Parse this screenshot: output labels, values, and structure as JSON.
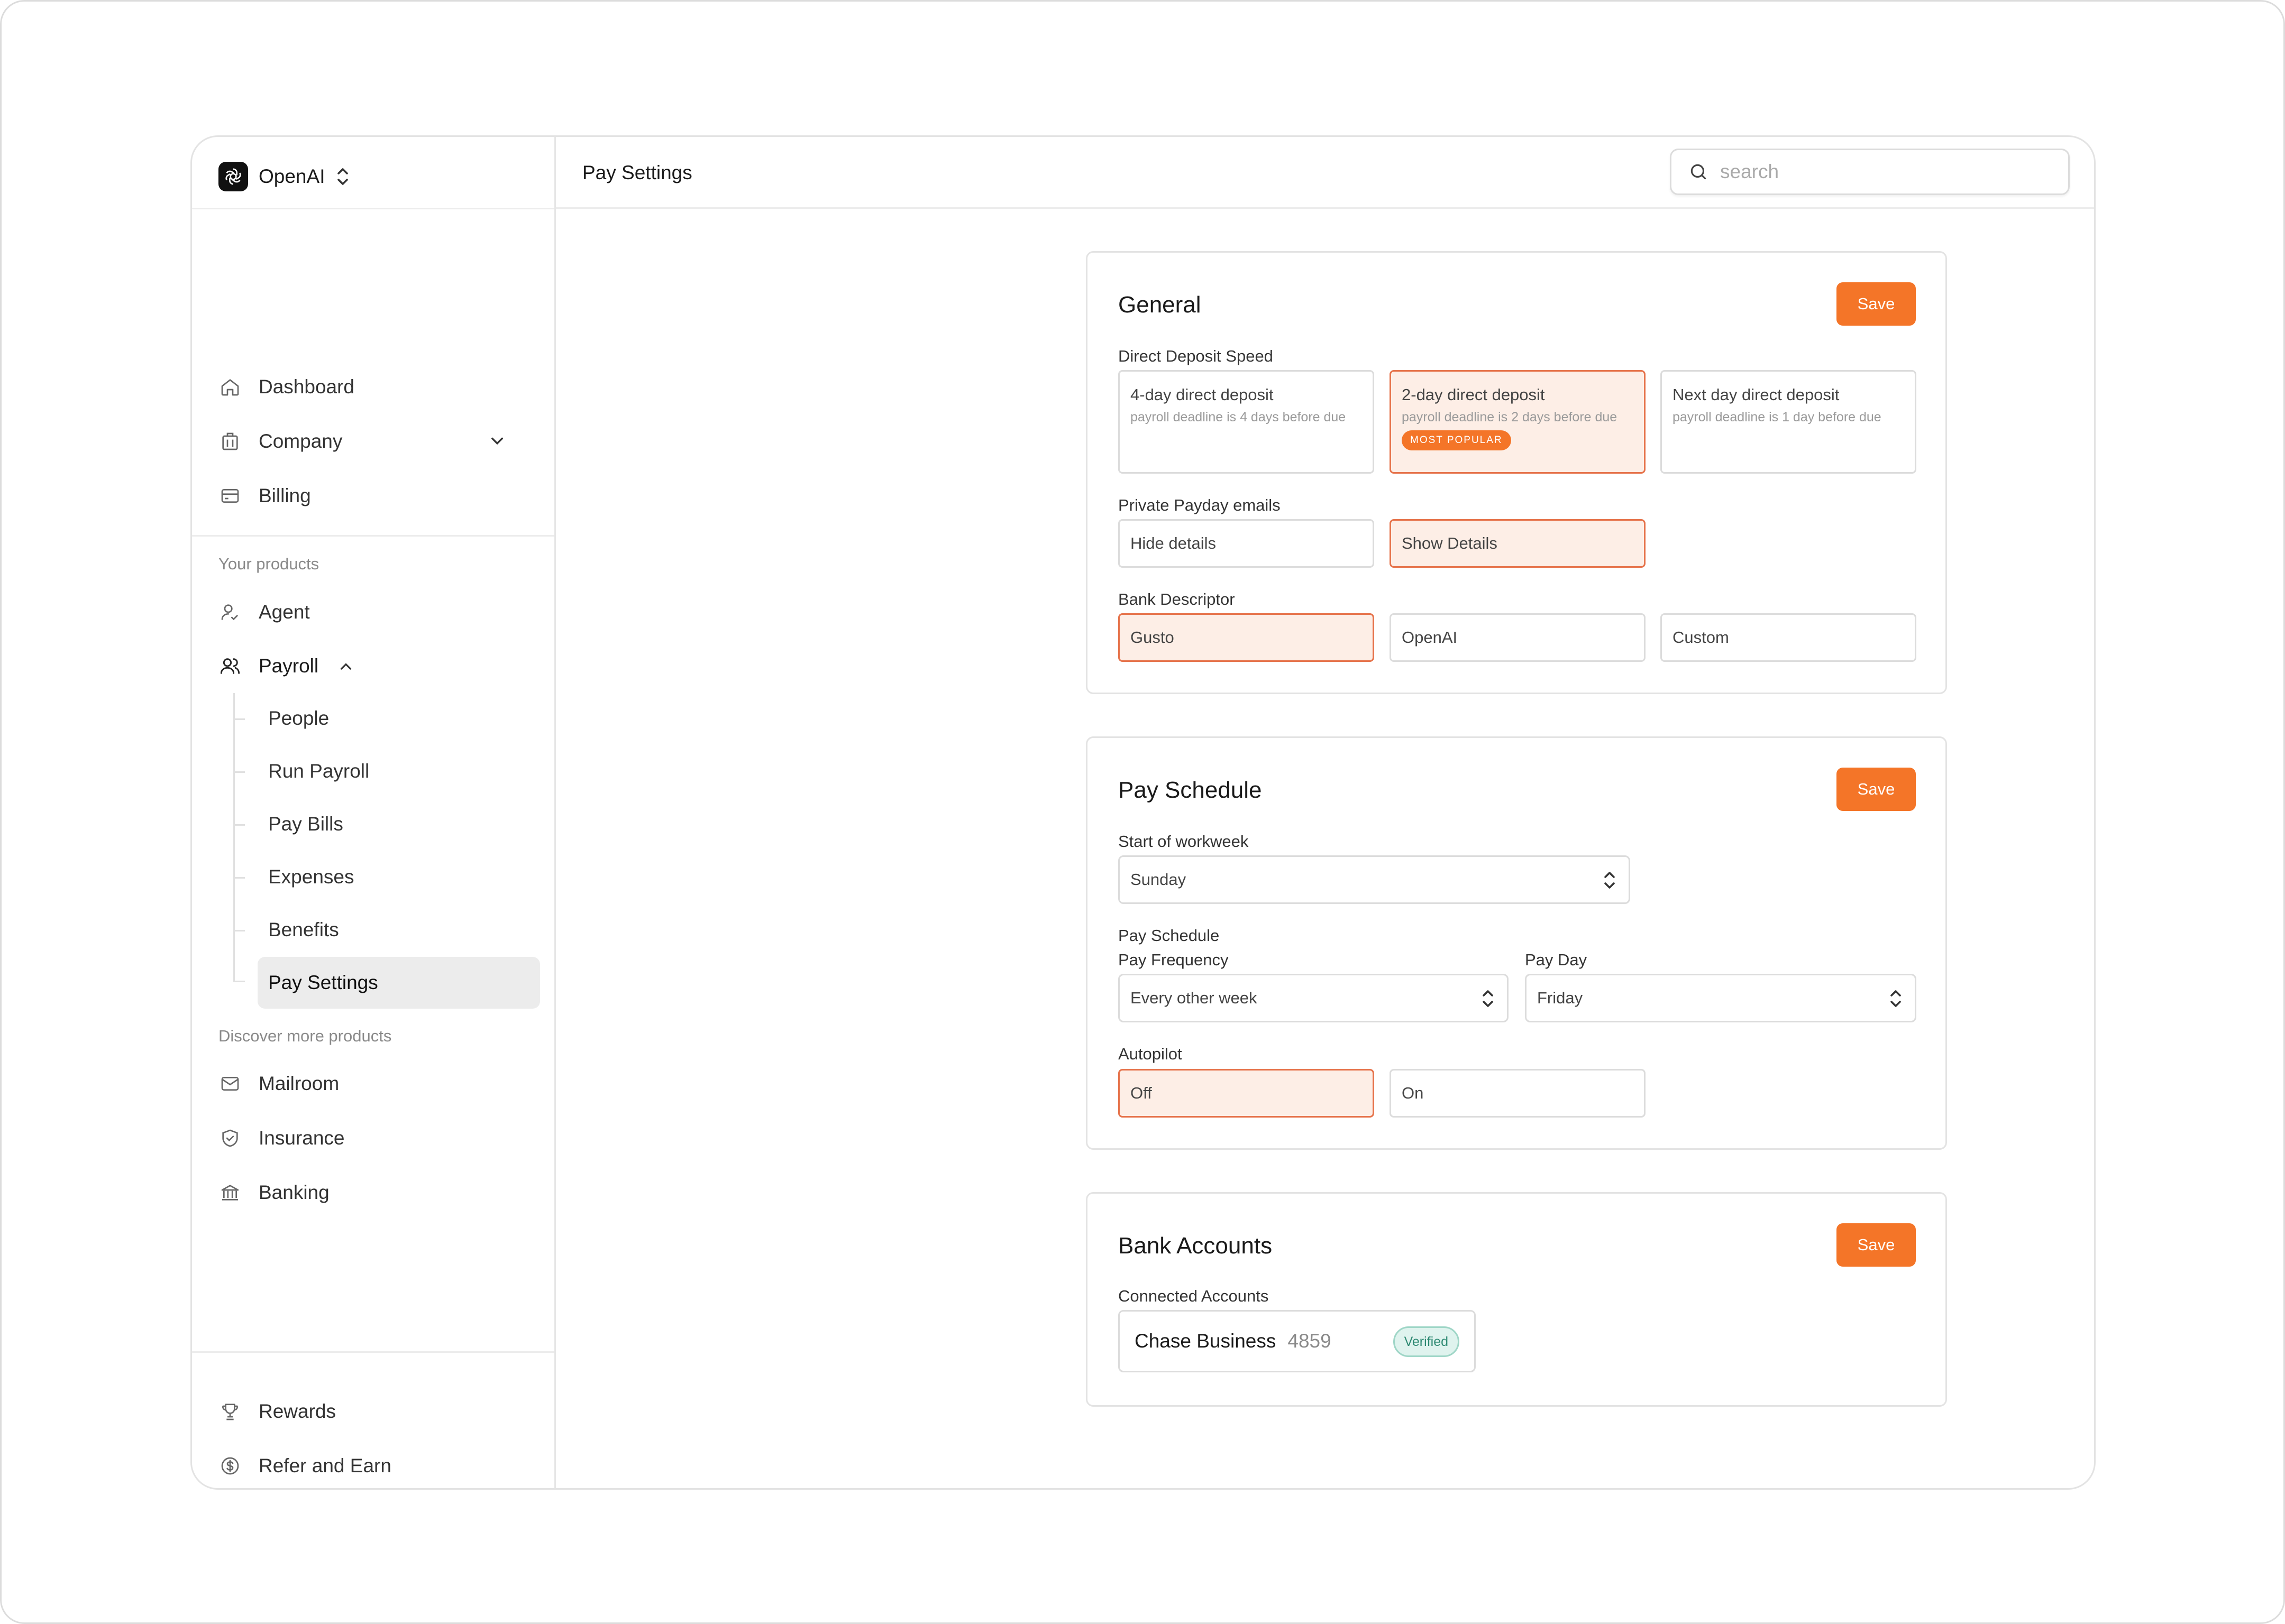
{
  "org": {
    "name": "OpenAI"
  },
  "sidebar": {
    "main_items": [
      {
        "label": "Dashboard",
        "icon": "home-icon"
      },
      {
        "label": "Company",
        "icon": "building-icon"
      },
      {
        "label": "Billing",
        "icon": "credit-card-icon"
      }
    ],
    "your_products_label": "Your products",
    "products": [
      {
        "label": "Agent",
        "icon": "user-check-icon"
      },
      {
        "label": "Payroll",
        "icon": "users-icon"
      }
    ],
    "payroll_sub": [
      "People",
      "Run Payroll",
      "Pay Bills",
      "Expenses",
      "Benefits",
      "Pay Settings"
    ],
    "discover_label": "Discover more products",
    "discover": [
      {
        "label": "Mailroom",
        "icon": "mail-icon"
      },
      {
        "label": "Insurance",
        "icon": "shield-check-icon"
      },
      {
        "label": "Banking",
        "icon": "bank-icon"
      }
    ],
    "footer": [
      {
        "label": "Rewards",
        "icon": "trophy-icon"
      },
      {
        "label": "Refer and Earn",
        "icon": "dollar-circle-icon"
      }
    ]
  },
  "header": {
    "title": "Pay Settings",
    "search_placeholder": "search"
  },
  "general": {
    "title": "General",
    "save": "Save",
    "deposit_label": "Direct Deposit Speed",
    "deposit_options": [
      {
        "title": "4-day direct deposit",
        "sub": "payroll deadline is 4 days before due"
      },
      {
        "title": "2-day direct deposit",
        "sub": "payroll deadline is 2 days before due",
        "badge": "MOST POPULAR"
      },
      {
        "title": "Next day direct deposit",
        "sub": "payroll deadline is 1 day before due"
      }
    ],
    "emails_label": "Private Payday emails",
    "emails_options": [
      "Hide details",
      "Show Details"
    ],
    "descriptor_label": "Bank Descriptor",
    "descriptor_options": [
      "Gusto",
      "OpenAI",
      "Custom"
    ]
  },
  "schedule": {
    "title": "Pay Schedule",
    "save": "Save",
    "workweek_label": "Start of workweek",
    "workweek_value": "Sunday",
    "schedule_label": "Pay Schedule",
    "frequency_label": "Pay Frequency",
    "frequency_value": "Every other week",
    "payday_label": "Pay Day",
    "payday_value": "Friday",
    "autopilot_label": "Autopilot",
    "autopilot_options": [
      "Off",
      "On"
    ]
  },
  "bank": {
    "title": "Bank Accounts",
    "save": "Save",
    "connected_label": "Connected Accounts",
    "account_name": "Chase Business",
    "account_number": "4859",
    "status": "Verified"
  },
  "colors": {
    "accent": "#f47528",
    "selected_bg": "#fdeee6",
    "selected_border": "#e6734b",
    "verified": "#2f8a73"
  }
}
